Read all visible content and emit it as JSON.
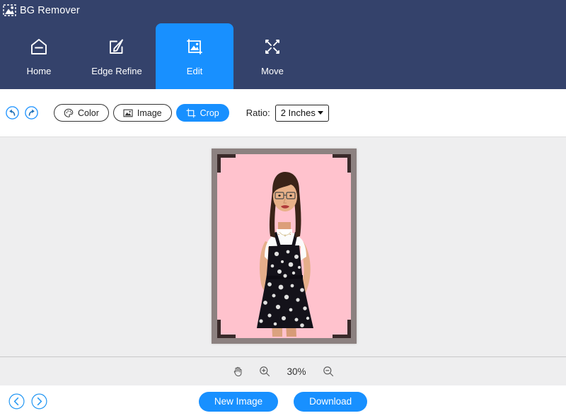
{
  "app": {
    "title": "BG Remover",
    "logo_icon": "image-photo-icon"
  },
  "nav": {
    "items": [
      {
        "label": "Home",
        "icon": "home-icon",
        "active": false
      },
      {
        "label": "Edge Refine",
        "icon": "pen-square-icon",
        "active": false
      },
      {
        "label": "Edit",
        "icon": "image-crop-icon",
        "active": true
      },
      {
        "label": "Move",
        "icon": "expand-arrows-icon",
        "active": false
      }
    ]
  },
  "toolbar": {
    "undo_icon": "undo-icon",
    "redo_icon": "redo-icon",
    "buttons": [
      {
        "label": "Color",
        "icon": "palette-icon",
        "active": false
      },
      {
        "label": "Image",
        "icon": "picture-icon",
        "active": false
      },
      {
        "label": "Crop",
        "icon": "crop-frame-icon",
        "active": true
      }
    ],
    "ratio_label": "Ratio:",
    "ratio_value": "2 Inches",
    "ratio_options": [
      "2 Inches"
    ]
  },
  "canvas": {
    "background_color": "#eeeeef",
    "photo_border_color": "#8c8180",
    "photo_background_color": "#ffc2cd",
    "crop_corner_color": "#3a2a2a",
    "subject_alt": "woman-in-floral-black-dress"
  },
  "zoombar": {
    "pan_icon": "hand-icon",
    "zoom_in_icon": "zoom-in-icon",
    "zoom_out_icon": "zoom-out-icon",
    "zoom_value": "30%"
  },
  "footer": {
    "prev_icon": "chevron-left-circle-icon",
    "next_icon": "chevron-right-circle-icon",
    "new_image_label": "New Image",
    "download_label": "Download"
  },
  "colors": {
    "header_navy": "#34426b",
    "accent_blue": "#1890ff",
    "panel_gray": "#eeeeef",
    "pink": "#ffc2cd"
  }
}
